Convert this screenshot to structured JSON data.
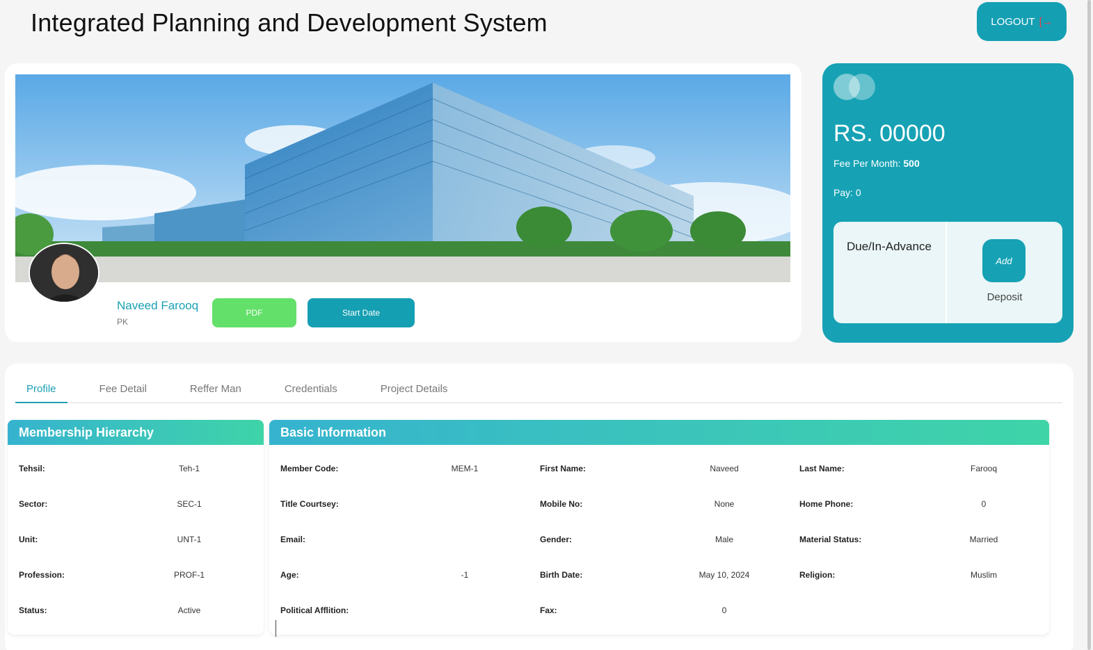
{
  "app": {
    "title": "Integrated Planning and Development System",
    "logout_label": "LOGOUT"
  },
  "profile": {
    "name": "Naveed Farooq",
    "country": "PK",
    "pdf_label": "PDF",
    "start_date_label": "Start Date"
  },
  "fee": {
    "balance": "RS. 00000",
    "fee_per_month_label": "Fee Per Month:",
    "fee_per_month_value": "500",
    "pay_label": "Pay:",
    "pay_value": "0",
    "due_label": "Due/In-Advance",
    "add_label": "Add",
    "deposit_label": "Deposit"
  },
  "tabs": [
    "Profile",
    "Fee Detail",
    "Reffer Man",
    "Credentials",
    "Project Details"
  ],
  "membership": {
    "title": "Membership Hierarchy",
    "rows": [
      {
        "label": "Tehsil:",
        "value": "Teh-1"
      },
      {
        "label": "Sector:",
        "value": "SEC-1"
      },
      {
        "label": "Unit:",
        "value": "UNT-1"
      },
      {
        "label": "Profession:",
        "value": "PROF-1"
      },
      {
        "label": "Status:",
        "value": "Active"
      }
    ]
  },
  "basic": {
    "title": "Basic Information",
    "col1": [
      {
        "label": "Member Code:",
        "value": "MEM-1"
      },
      {
        "label": "Title Courtsey:",
        "value": ""
      },
      {
        "label": "Email:",
        "value": ""
      },
      {
        "label": "Age:",
        "value": "-1"
      },
      {
        "label": "Political Afflition:",
        "value": ""
      }
    ],
    "col2": [
      {
        "label": "First Name:",
        "value": "Naveed"
      },
      {
        "label": "Mobile No:",
        "value": "None"
      },
      {
        "label": "Gender:",
        "value": "Male"
      },
      {
        "label": "Birth Date:",
        "value": "May 10, 2024"
      },
      {
        "label": "Fax:",
        "value": "0"
      }
    ],
    "col3": [
      {
        "label": "Last Name:",
        "value": "Farooq"
      },
      {
        "label": "Home Phone:",
        "value": "0"
      },
      {
        "label": "Material Status:",
        "value": "Married"
      },
      {
        "label": "Religion:",
        "value": "Muslim"
      }
    ]
  }
}
